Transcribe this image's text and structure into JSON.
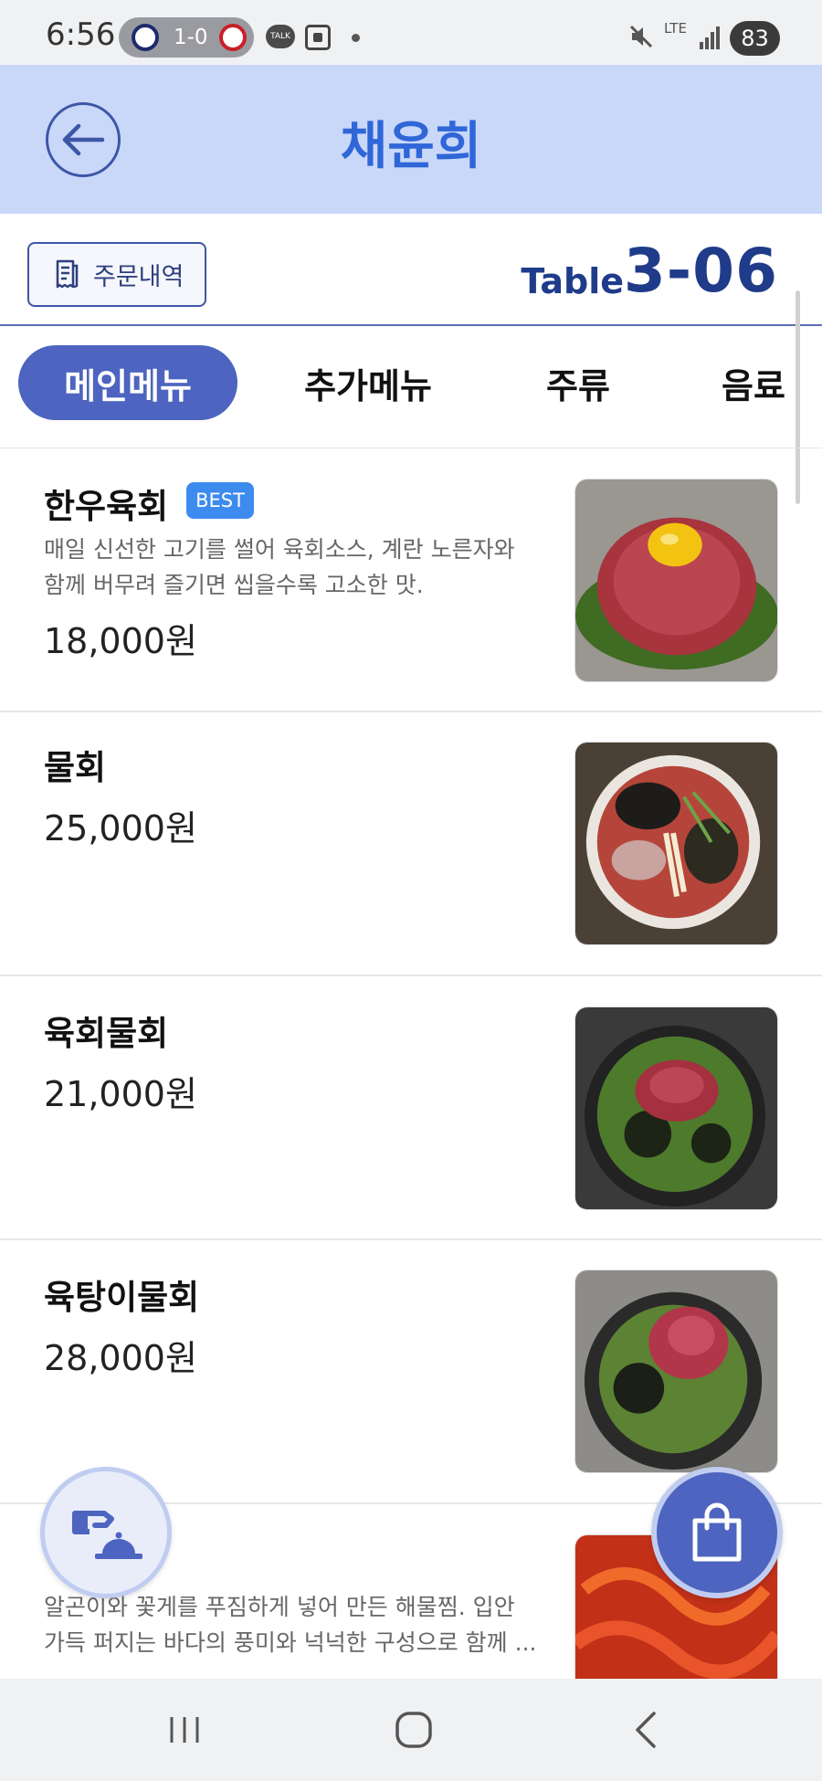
{
  "status_bar": {
    "time": "6:56",
    "score": "1-0",
    "talk_label": "TALK",
    "network": "LTE",
    "battery": "83"
  },
  "header": {
    "title": "채윤희"
  },
  "order_bar": {
    "order_history_label": "주문내역",
    "table_label": "Table",
    "table_number": "3-06"
  },
  "tabs": [
    {
      "label": "메인메뉴",
      "active": true
    },
    {
      "label": "추가메뉴",
      "active": false
    },
    {
      "label": "주류",
      "active": false
    },
    {
      "label": "음료",
      "active": false
    }
  ],
  "menu": [
    {
      "name": "한우육회",
      "badge": "BEST",
      "description_line1": "매일 신선한 고기를 썰어 육회소스, 계란 노른자와",
      "description_line2": "함께 버무려 즐기면 씹을수록 고소한 맛.",
      "price": "18,000원"
    },
    {
      "name": "물회",
      "price": "25,000원"
    },
    {
      "name": "육회물회",
      "price": "21,000원"
    },
    {
      "name": "육탕이물회",
      "price": "28,000원"
    },
    {
      "name": "",
      "description_line1": "알곤이와 꽃게를 푸짐하게 넣어 만든 해물찜. 입안",
      "description_line2": "가득 퍼지는 바다의 풍미와 넉넉한 구성으로 함께 ..."
    }
  ],
  "colors": {
    "header_bg": "#c9d7f8",
    "accent": "#4d64c0",
    "title_blue": "#2f66d8",
    "badge_blue": "#3d8bef"
  }
}
